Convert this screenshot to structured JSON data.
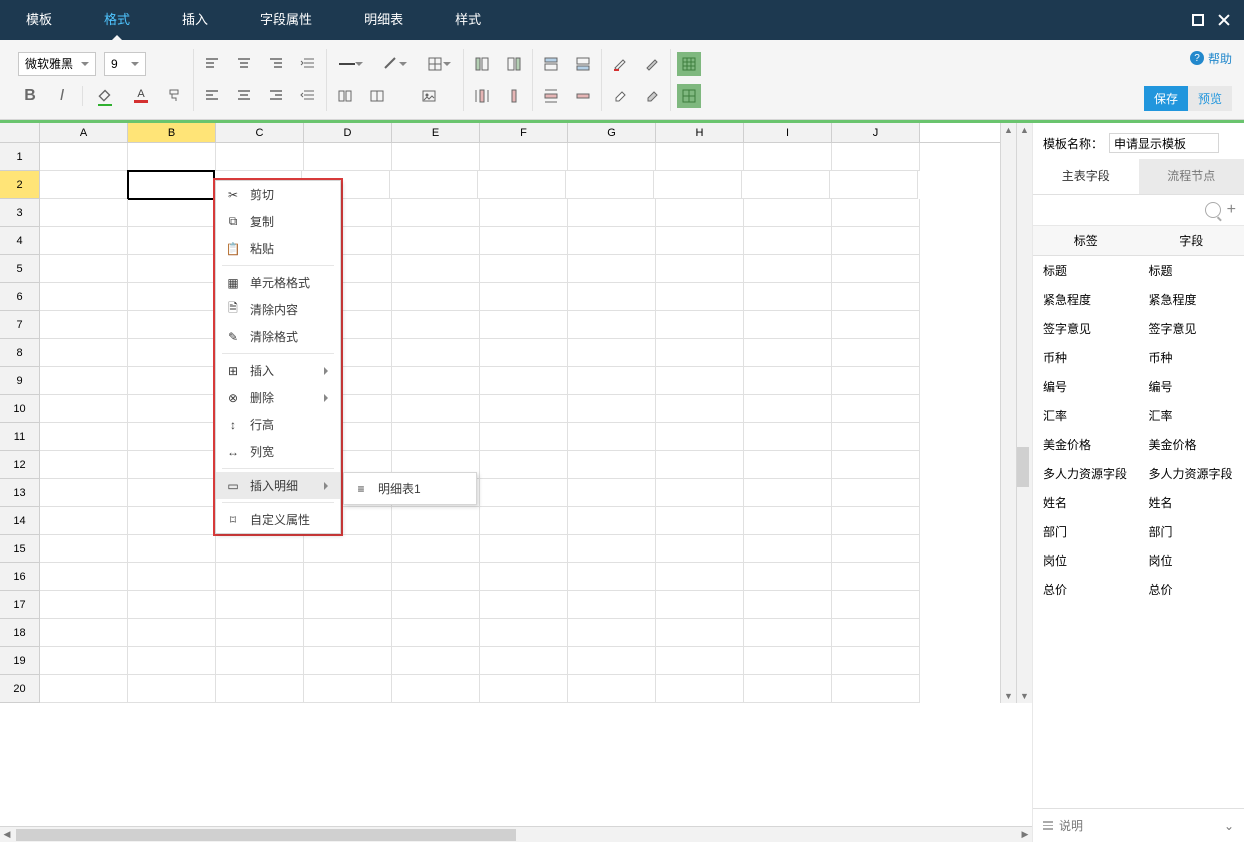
{
  "menubar": {
    "tabs": [
      "模板",
      "格式",
      "插入",
      "字段属性",
      "明细表",
      "样式"
    ],
    "active_index": 1
  },
  "ribbon": {
    "font_name": "微软雅黑",
    "font_size": "9",
    "help_label": "帮助",
    "save_label": "保存",
    "preview_label": "预览"
  },
  "spreadsheet": {
    "columns": [
      "A",
      "B",
      "C",
      "D",
      "E",
      "F",
      "G",
      "H",
      "I",
      "J"
    ],
    "rows": [
      "1",
      "2",
      "3",
      "4",
      "5",
      "6",
      "7",
      "8",
      "9",
      "10",
      "11",
      "12",
      "13",
      "14",
      "15",
      "16",
      "17",
      "18",
      "19",
      "20"
    ],
    "selected_col_index": 1,
    "selected_row_index": 1
  },
  "context_menu": {
    "cut": "剪切",
    "copy": "复制",
    "paste": "粘贴",
    "cell_format": "单元格格式",
    "clear_content": "清除内容",
    "clear_format": "清除格式",
    "insert": "插入",
    "delete": "删除",
    "row_height": "行高",
    "col_width": "列宽",
    "insert_detail": "插入明细",
    "custom_attr": "自定义属性",
    "submenu_item": "明细表1"
  },
  "right_panel": {
    "tpl_name_label": "模板名称：",
    "tpl_name_value": "申请显示模板",
    "tabs": {
      "main_fields": "主表字段",
      "flow_nodes": "流程节点"
    },
    "col_label": "标签",
    "col_field": "字段",
    "fields": [
      {
        "label": "标题",
        "field": "标题"
      },
      {
        "label": "紧急程度",
        "field": "紧急程度"
      },
      {
        "label": "签字意见",
        "field": "签字意见"
      },
      {
        "label": "币种",
        "field": "币种"
      },
      {
        "label": "编号",
        "field": "编号"
      },
      {
        "label": "汇率",
        "field": "汇率"
      },
      {
        "label": "美金价格",
        "field": "美金价格"
      },
      {
        "label": "多人力资源字段",
        "field": "多人力资源字段"
      },
      {
        "label": "姓名",
        "field": "姓名"
      },
      {
        "label": "部门",
        "field": "部门"
      },
      {
        "label": "岗位",
        "field": "岗位"
      },
      {
        "label": "总价",
        "field": "总价"
      }
    ],
    "desc_label": "说明",
    "caret": "⌄"
  }
}
